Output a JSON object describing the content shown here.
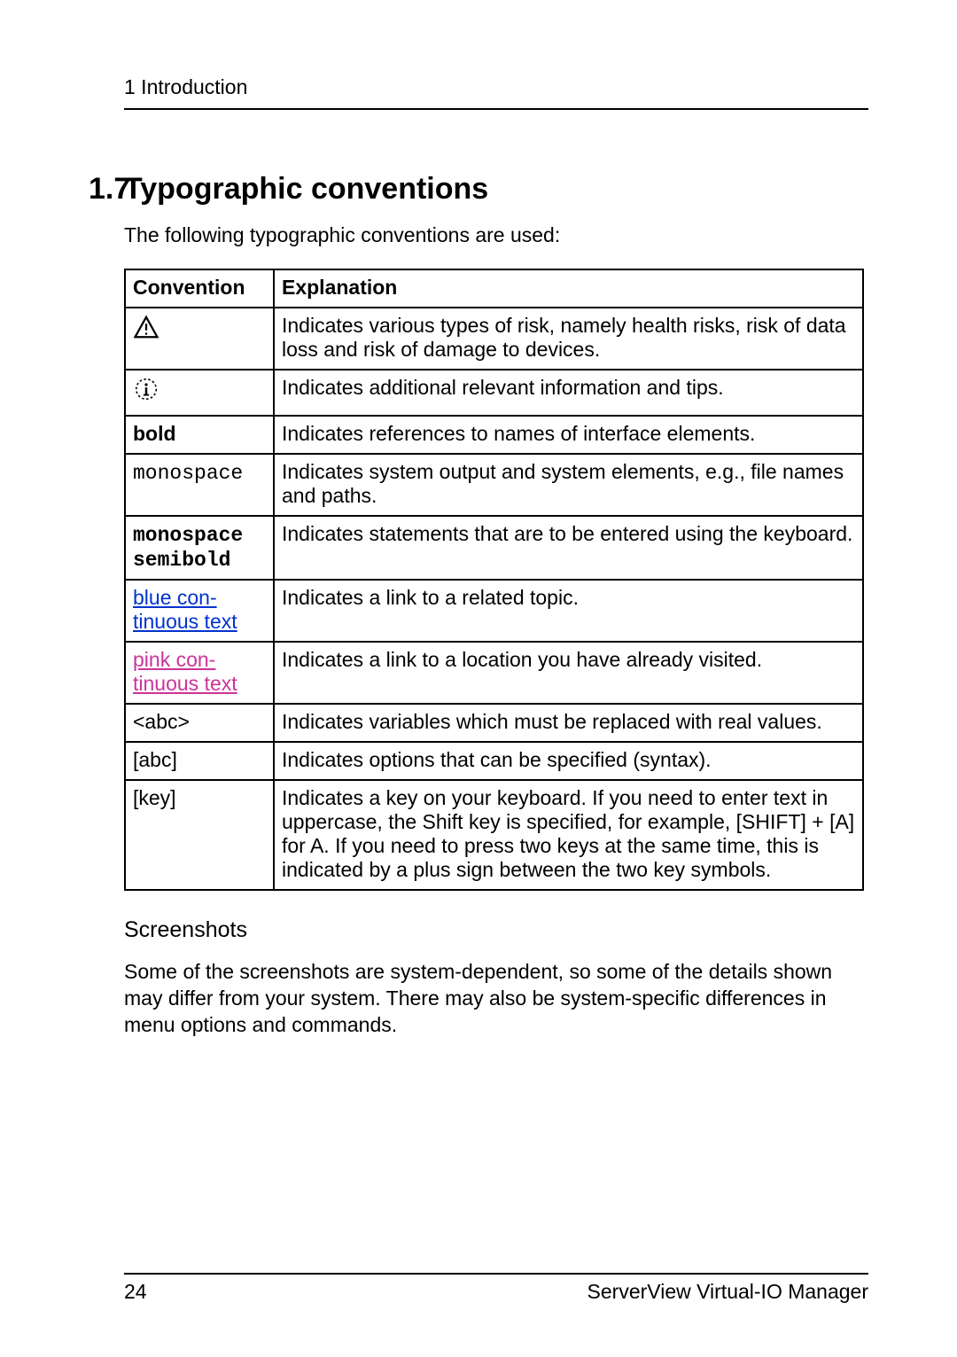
{
  "running_head": "1 Introduction",
  "heading": {
    "number": "1.7",
    "title": "Typographic conventions"
  },
  "intro": "The following typographic conventions are used:",
  "table": {
    "headers": {
      "c1": "Convention",
      "c2": "Explanation"
    },
    "rows": [
      {
        "conv_icon": "warning",
        "exp": "Indicates various types of risk, namely health risks, risk of data loss and risk of damage to devices."
      },
      {
        "conv_icon": "info",
        "exp": "Indicates additional relevant information and tips."
      },
      {
        "conv_text": "bold",
        "conv_style": "bold",
        "exp": "Indicates references to names of interface elements."
      },
      {
        "conv_text": "monospace",
        "conv_style": "mono",
        "exp": "Indicates system output and system elements, e.g., file names and paths."
      },
      {
        "conv_text": "monospace semibold",
        "conv_style": "mono-semi",
        "exp": "Indicates statements that are to be entered using the keyboard."
      },
      {
        "conv_text": "blue continuous text",
        "conv_style": "link-blue",
        "exp": "Indicates a link to a related topic."
      },
      {
        "conv_text": "pink continuous text",
        "conv_style": "link-pink",
        "exp": "Indicates a link to a location you have already visited."
      },
      {
        "conv_text": "<abc>",
        "conv_style": "plain",
        "exp": "Indicates variables which must be replaced with real values."
      },
      {
        "conv_text": "[abc]",
        "conv_style": "plain",
        "exp": "Indicates options that can be specified (syntax)."
      },
      {
        "conv_text": "[key]",
        "conv_style": "plain",
        "exp": "Indicates a key on your keyboard. If you need to enter text in uppercase, the Shift key is specified, for example, [SHIFT] + [A] for A. If you need to press two keys at the same time, this is indicated by a plus sign between the two key symbols."
      }
    ]
  },
  "subhead": "Screenshots",
  "screenshots_para": "Some of the screenshots are system-dependent, so some of the details shown may differ from your system. There may also be system-specific differences in menu options and commands.",
  "footer": {
    "page": "24",
    "product": "ServerView Virtual-IO Manager"
  },
  "blue_linebreak": {
    "l1": "blue con-",
    "l2": "tinuous text"
  },
  "pink_linebreak": {
    "l1": "pink con-",
    "l2": "tinuous text"
  },
  "mono_semi_lines": {
    "l1": "monospace",
    "l2": "semibold"
  }
}
